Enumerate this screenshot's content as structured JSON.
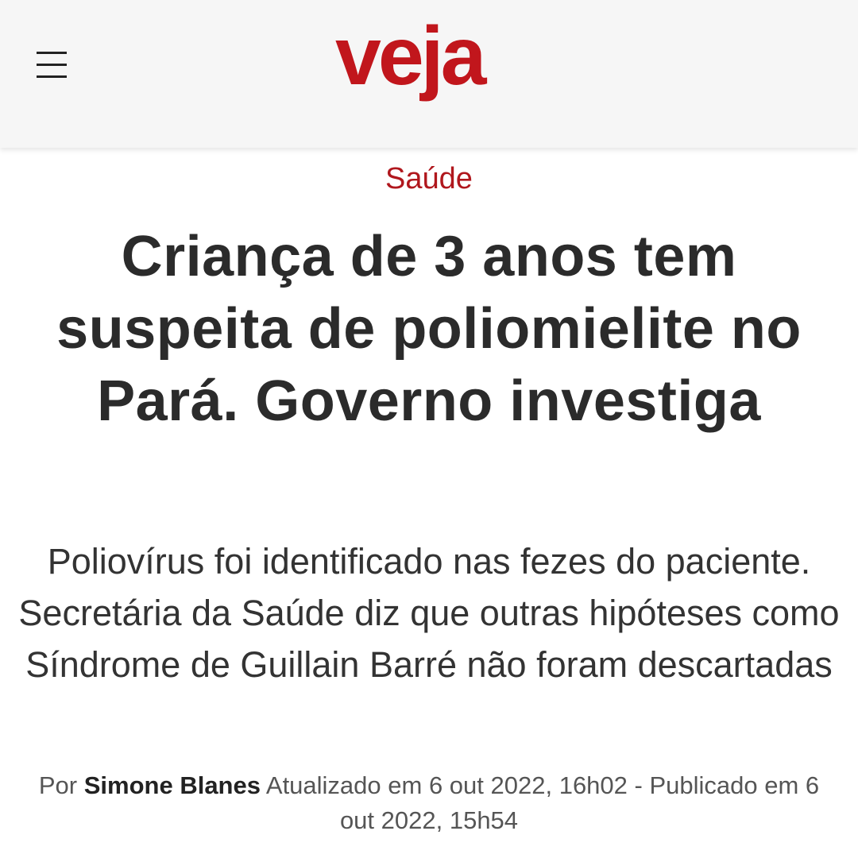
{
  "header": {
    "logo_text": "veja",
    "menu_icon": "hamburger-menu-icon",
    "brand_color": "#c1161c"
  },
  "article": {
    "section": "Saúde",
    "headline": "Criança de 3 anos tem suspeita de poliomielite no Pará. Governo investiga",
    "subtitle": "Poliovírus foi identificado nas fezes do paciente. Secretária da Saúde diz que outras hipóteses como Síndrome de Guillain Barré não foram descartadas",
    "byline": {
      "prefix": "Por",
      "author": "Simone Blanes",
      "updated": "Atualizado em 6 out 2022, 16h02 - Publicado em 6 out 2022, 15h54"
    }
  }
}
